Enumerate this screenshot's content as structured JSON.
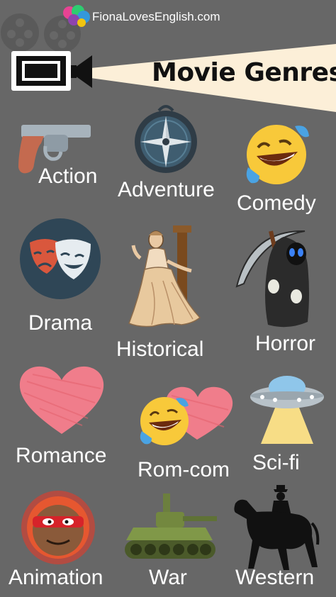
{
  "brand": {
    "name": "FionaLovesEnglish.com"
  },
  "title": "Movie Genres",
  "colors": {
    "background": "#676767",
    "banner": "#fcefd8",
    "text": "#ffffff",
    "title": "#111111"
  },
  "genres": [
    {
      "label": "Action",
      "icon": "revolver-icon"
    },
    {
      "label": "Adventure",
      "icon": "compass-icon"
    },
    {
      "label": "Comedy",
      "icon": "laughing-face-icon"
    },
    {
      "label": "Drama",
      "icon": "theater-masks-icon"
    },
    {
      "label": "Historical",
      "icon": "historical-lady-icon"
    },
    {
      "label": "Horror",
      "icon": "grim-reaper-icon"
    },
    {
      "label": "Romance",
      "icon": "heart-icon"
    },
    {
      "label": "Rom-com",
      "icon": "heart-and-laughing-face-icon"
    },
    {
      "label": "Sci-fi",
      "icon": "ufo-icon"
    },
    {
      "label": "Animation",
      "icon": "cartoon-face-icon"
    },
    {
      "label": "War",
      "icon": "tank-icon"
    },
    {
      "label": "Western",
      "icon": "cowboy-on-horse-icon"
    }
  ]
}
